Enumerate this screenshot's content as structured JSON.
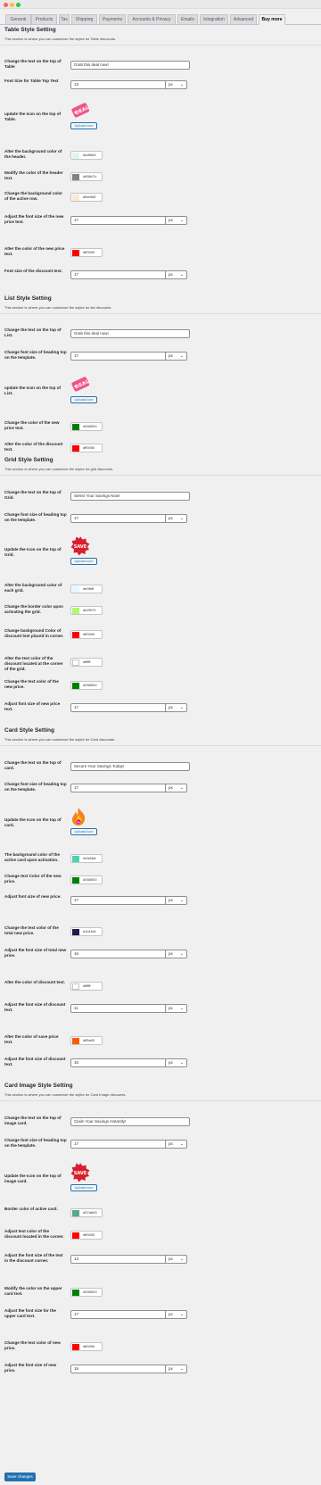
{
  "window": {
    "dot_colors": [
      "#ff5f57",
      "#febc2e",
      "#28c840"
    ]
  },
  "tabs": [
    {
      "label": "General"
    },
    {
      "label": "Products"
    },
    {
      "label": "Tax"
    },
    {
      "label": "Shipping"
    },
    {
      "label": "Payments"
    },
    {
      "label": "Accounts & Privacy"
    },
    {
      "label": "Emails"
    },
    {
      "label": "Integration"
    },
    {
      "label": "Advanced"
    },
    {
      "label": "Buy more",
      "active": true
    }
  ],
  "colors": {
    "accent": "#2271b1"
  },
  "sections": [
    {
      "title": "Table Style Setting",
      "description": "This section is where you can customize the styles for Table discounts.",
      "fields": [
        {
          "label": "Change the text on the top of Table",
          "type": "text",
          "value": "Grab this deal now!"
        },
        {
          "label": "Font Size for Table Top Text",
          "type": "number",
          "value": "13",
          "unit": "px"
        },
        {
          "label": "update the Icon on the top of Table.",
          "type": "icon",
          "icon": "deal-tag-icon",
          "button": "Upload icon"
        },
        {
          "label": "Alter the background color of the header.",
          "type": "color",
          "value": "#ddf9e5"
        },
        {
          "label": "Modify the color of the header text.",
          "type": "color",
          "value": "#80847c"
        },
        {
          "label": "Change the background color of the active row.",
          "type": "color",
          "value": "#fbe9d5"
        },
        {
          "label": "Adjust the font size of the new price text.",
          "type": "number",
          "value": "17",
          "unit": "px"
        },
        {
          "label": "Alter the color of the new price text.",
          "type": "color",
          "value": "#ff0000"
        },
        {
          "label": "Font size of the discount text.",
          "type": "number",
          "value": "17",
          "unit": "px"
        }
      ]
    },
    {
      "title": "List Style Setting",
      "description": "This section is where you can customize the styles for list discounts.",
      "fields": [
        {
          "label": "Change the text on the top of List.",
          "type": "text",
          "value": "Grab this deal now!"
        },
        {
          "label": "Change font size of heading top on the template.",
          "type": "number",
          "value": "17",
          "unit": "px"
        },
        {
          "label": "update the Icon on the top of List.",
          "type": "icon",
          "icon": "deal-tag-icon",
          "button": "Upload icon"
        },
        {
          "label": "Change the color of the new price text.",
          "type": "color",
          "value": "#008000"
        },
        {
          "label": "Alter the color of the discount text.",
          "type": "color",
          "value": "#ff0000"
        }
      ]
    },
    {
      "title": "Grid Style Setting",
      "description": "This section is where you can customize the styles for grid discounts.",
      "fields": [
        {
          "label": "Change the text on the top of Grid.",
          "type": "text",
          "value": "Select Your Savings Now!"
        },
        {
          "label": "Change font size of heading top on the template.",
          "type": "number",
          "value": "17",
          "unit": "px"
        },
        {
          "label": "Update the Icon on the top of Grid.",
          "type": "icon",
          "icon": "save-badge-icon",
          "button": "Upload icon"
        },
        {
          "label": "Alter the background color of each grid.",
          "type": "color",
          "value": "#e0fbff"
        },
        {
          "label": "Change the border color upon activating the grid.",
          "type": "color",
          "value": "#b2f970"
        },
        {
          "label": "Change background Color of discount text placed in corner.",
          "type": "color",
          "value": "#ff0000"
        },
        {
          "label": "Alter the text color of the discount located at the corner of the grid.",
          "type": "color",
          "value": "#ffffff"
        },
        {
          "label": "Change the text color of the new price.",
          "type": "color",
          "value": "#008000"
        },
        {
          "label": "Adjust font size of new price text.",
          "type": "number",
          "value": "17",
          "unit": "px"
        }
      ]
    },
    {
      "title": "Card Style Setting",
      "description": "This section is where you can customize the styles for Card discounts.",
      "fields": [
        {
          "label": "Change the text on the top of card.",
          "type": "text",
          "value": "Secure Your Savings Today!"
        },
        {
          "label": "Change font size of heading top on the template.",
          "type": "number",
          "value": "17",
          "unit": "px"
        },
        {
          "label": "Update the Icon on the top of card.",
          "type": "icon",
          "icon": "fire-icon",
          "button": "Upload icon"
        },
        {
          "label": "The background color of the active card upon activation.",
          "type": "color",
          "value": "#49d4af"
        },
        {
          "label": "Change text Color of the new price.",
          "type": "color",
          "value": "#008000"
        },
        {
          "label": "Adjust font size of new price.",
          "type": "number",
          "value": "17",
          "unit": "px"
        },
        {
          "label": "Change the text color of the total new price.",
          "type": "color",
          "value": "#1b1b4f"
        },
        {
          "label": "Adjust the font size of total new price.",
          "type": "number",
          "value": "16",
          "unit": "px"
        },
        {
          "label": "Alter the color of discount text.",
          "type": "color",
          "value": "#ffffff"
        },
        {
          "label": "Adjust the font size of discount text.",
          "type": "number",
          "value": "11",
          "unit": "px"
        },
        {
          "label": "Alter the color of save price text.",
          "type": "color",
          "value": "#ff5a00"
        },
        {
          "label": "Adjust the font size of discount text.",
          "type": "number",
          "value": "15",
          "unit": "px"
        }
      ]
    },
    {
      "title": "Card Image Style Setting",
      "description": "This section is where you can customize the styles for Card Image discounts.",
      "fields": [
        {
          "label": "Change the text on the top of image card.",
          "type": "text",
          "value": "Claim Your Savings Instantly!"
        },
        {
          "label": "Change font size of heading top on the template.",
          "type": "number",
          "value": "17",
          "unit": "px"
        },
        {
          "label": "Update the Icon on the top of image card.",
          "type": "icon",
          "icon": "save-badge-icon",
          "button": "Upload icon"
        },
        {
          "label": "Border color of active card.",
          "type": "color",
          "value": "#57a693"
        },
        {
          "label": "Adjust text color of the discount located in the corner.",
          "type": "color",
          "value": "#ff0000"
        },
        {
          "label": "Adjust the font size of the text in the discount corner.",
          "type": "number",
          "value": "13",
          "unit": "px"
        },
        {
          "label": "Modify the color on the upper card text.",
          "type": "color",
          "value": "#008000"
        },
        {
          "label": "Adjust the font size for the upper card text.",
          "type": "number",
          "value": "17",
          "unit": "px"
        },
        {
          "label": "Change the text color of new price.",
          "type": "color",
          "value": "#ff0000"
        },
        {
          "label": "Adjust the font size of new price.",
          "type": "number",
          "value": "16",
          "unit": "px"
        }
      ]
    }
  ],
  "save_button": "Save changes"
}
